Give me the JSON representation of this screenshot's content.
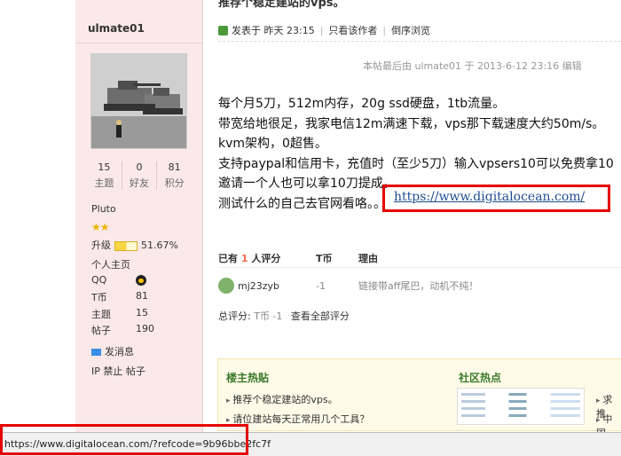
{
  "author": {
    "username": "ulmate01",
    "stats": [
      {
        "value": "15",
        "label": "主题"
      },
      {
        "value": "0",
        "label": "好友"
      },
      {
        "value": "81",
        "label": "积分"
      }
    ],
    "group": "Pluto",
    "level_label": "升级",
    "level_percent": "51.67%",
    "level_fraction": 0.5167,
    "profile_link": "个人主页",
    "info": [
      {
        "key": "QQ",
        "value": ""
      },
      {
        "key": "T币",
        "value": "81"
      },
      {
        "key": "主题",
        "value": "15"
      },
      {
        "key": "帖子",
        "value": "190"
      }
    ],
    "send_msg": "发消息",
    "ip_ban": "IP 禁止 帖子"
  },
  "post": {
    "top_title": "推荐个稳定建站的vps。",
    "posted_at": "发表于 昨天 23:15",
    "only_author": "只看该作者",
    "reverse_view": "倒序浏览",
    "edited_note": "本帖最后由 ulmate01 于 2013-6-12 23:16 编辑",
    "body_lines": [
      "每个月5刀，512m内存，20g ssd硬盘，1tb流量。",
      "带宽给地很足，我家电信12m满速下载，vps那下载速度大约50m/s。",
      "kvm架构，0超售。",
      "支持paypal和信用卡，充值时（至少5刀）输入vpsers10可以免费拿10",
      "邀请一个人也可以拿10刀提成。",
      "测试什么的自己去官网看咯。。"
    ],
    "link_text": "https://www.digitalocean.com/"
  },
  "rating": {
    "header_prefix": "已有",
    "count": "1",
    "header_suffix": "人评分",
    "col_currency": "T币",
    "col_reason": "理由",
    "rows": [
      {
        "user": "mj23zyb",
        "value": "-1",
        "reason": "链接带aff尾巴，动机不纯！"
      }
    ],
    "total_label": "总评分:",
    "total_value": "T币 -1",
    "view_all": "查看全部评分"
  },
  "panel": {
    "left_title": "楼主热贴",
    "left_items": [
      "推荐个稳定建站的vps。",
      "请位建站每天正常用几个工具？"
    ],
    "right_title": "社区热点",
    "far_right": [
      "求推",
      "中国"
    ]
  },
  "status_bar": {
    "url": "https://www.digitalocean.com/?refcode=9b96bbe2fc7f"
  }
}
